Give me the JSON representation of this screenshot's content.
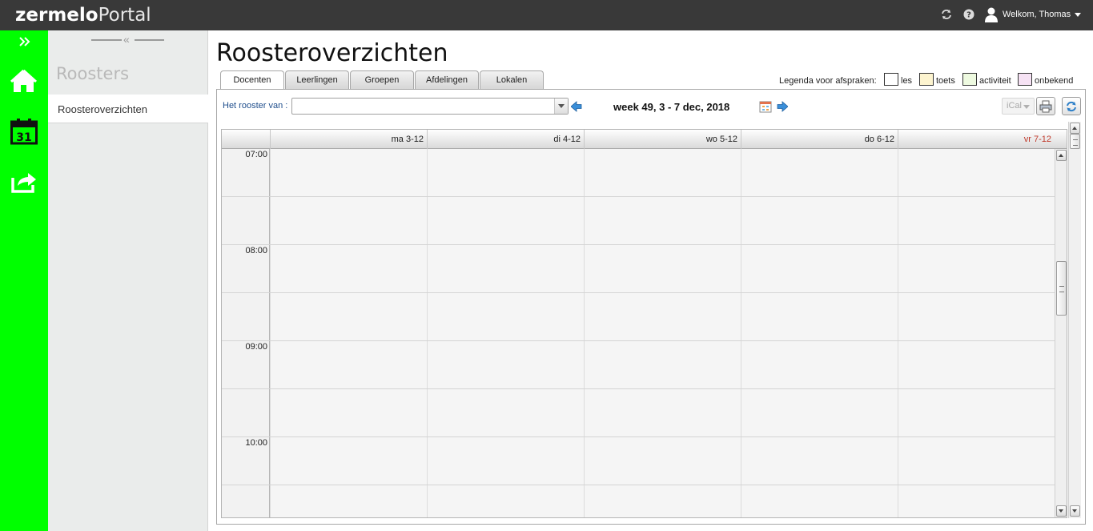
{
  "app": {
    "brand_bold": "zermelo",
    "brand_light": "Portal",
    "welcome": "Welkom, Thomas"
  },
  "nav": {
    "icons": [
      "expand-icon",
      "home-icon",
      "calendar-icon",
      "share-icon"
    ],
    "calendar_day": "31",
    "accent_color": "#00ff00"
  },
  "sidebar": {
    "title": "Roosters",
    "items": [
      {
        "label": "Roosteroverzichten",
        "selected": true
      }
    ]
  },
  "main": {
    "title": "Roosteroverzichten",
    "tabs": [
      {
        "label": "Docenten",
        "active": true
      },
      {
        "label": "Leerlingen",
        "active": false
      },
      {
        "label": "Groepen",
        "active": false
      },
      {
        "label": "Afdelingen",
        "active": false
      },
      {
        "label": "Lokalen",
        "active": false
      }
    ],
    "legend": {
      "label": "Legenda voor afspraken:",
      "items": [
        {
          "label": "les",
          "color": "#ffffff"
        },
        {
          "label": "toets",
          "color": "#fdf4cf"
        },
        {
          "label": "activiteit",
          "color": "#eefae0"
        },
        {
          "label": "onbekend",
          "color": "#f6e2f4"
        }
      ]
    },
    "toolbar": {
      "rooster_label": "Het rooster van :",
      "rooster_value": "",
      "week_label": "week 49, 3 - 7 dec, 2018",
      "ical_label": "iCal"
    },
    "schedule": {
      "days": [
        {
          "label": "ma 3-12",
          "highlight": false
        },
        {
          "label": "di 4-12",
          "highlight": false
        },
        {
          "label": "wo 5-12",
          "highlight": false
        },
        {
          "label": "do 6-12",
          "highlight": false
        },
        {
          "label": "vr 7-12",
          "highlight": true
        }
      ],
      "times": [
        "07:00",
        "08:00",
        "09:00",
        "10:00"
      ]
    }
  }
}
